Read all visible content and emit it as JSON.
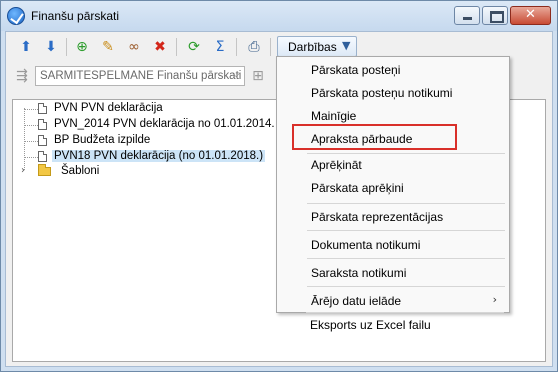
{
  "window": {
    "title": "Finanšu pārskati"
  },
  "toolbar": {
    "actions_label": "Darbības",
    "actions_caret": "▼",
    "icons": [
      "arrow-up-icon",
      "arrow-down-icon",
      "new-doc-icon",
      "edit-icon",
      "glasses-icon",
      "delete-icon",
      "refresh-icon",
      "sum-icon",
      "print-icon"
    ]
  },
  "filter": {
    "combo_value": "SARMITESPELMANE Finanšu pārskati",
    "combo_arrow": "⌵"
  },
  "tree": {
    "items": [
      {
        "label": "PVN   PVN deklarācija"
      },
      {
        "label": "PVN_2014   PVN deklarācija no 01.01.2014."
      },
      {
        "label": "BP   Budžeta izpilde"
      },
      {
        "label": "PVN18   PVN deklarācija (no 01.01.2018.)"
      },
      {
        "label": "Šabloni"
      }
    ],
    "expander": "›"
  },
  "menu": {
    "items": [
      "Pārskata posteņi",
      "Pārskata posteņu notikumi",
      "Mainīgie",
      "Apraksta pārbaude",
      "Aprēķināt",
      "Pārskata aprēķini",
      "Pārskata reprezentācijas",
      "Dokumenta notikumi",
      "Saraksta notikumi",
      "Ārējo datu ielāde",
      "Eksports uz Excel failu"
    ],
    "submenu_arrow": "›",
    "highlight_color": "#d9302a"
  }
}
